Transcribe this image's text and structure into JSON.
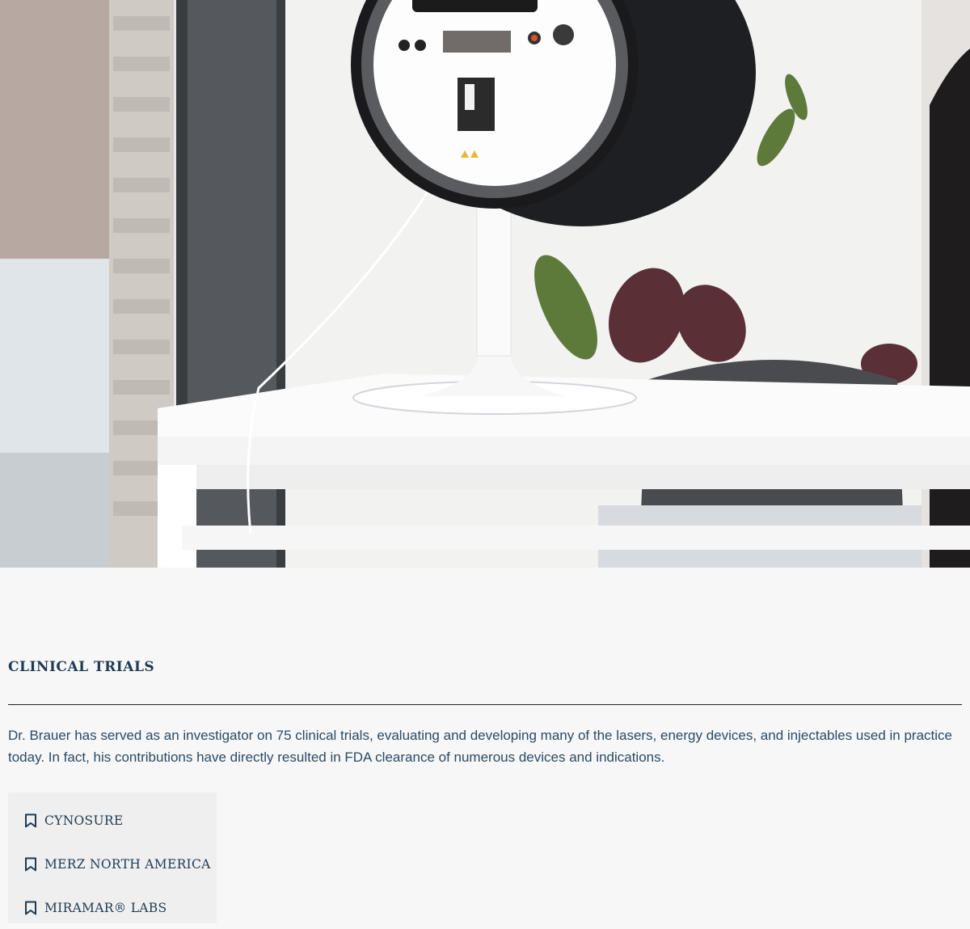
{
  "hero": {
    "icon": "skin-imaging-device-photo"
  },
  "section": {
    "title": "CLINICAL TRIALS",
    "description": "Dr. Brauer has served as an investigator on 75 clinical trials, evaluating and developing many of the lasers, energy devices, and injectables used in practice today. In fact, his contributions have directly resulted in FDA clearance of numerous devices and indications."
  },
  "sponsors": [
    {
      "label": "CYNOSURE",
      "icon": "bookmark-icon"
    },
    {
      "label": "MERZ NORTH AMERICA",
      "icon": "bookmark-icon"
    },
    {
      "label": "MIRAMAR® LABS",
      "icon": "bookmark-icon"
    }
  ],
  "colors": {
    "page_background": "#f7f7f7",
    "text_navy": "#1f3a52",
    "list_background": "#efefef"
  }
}
